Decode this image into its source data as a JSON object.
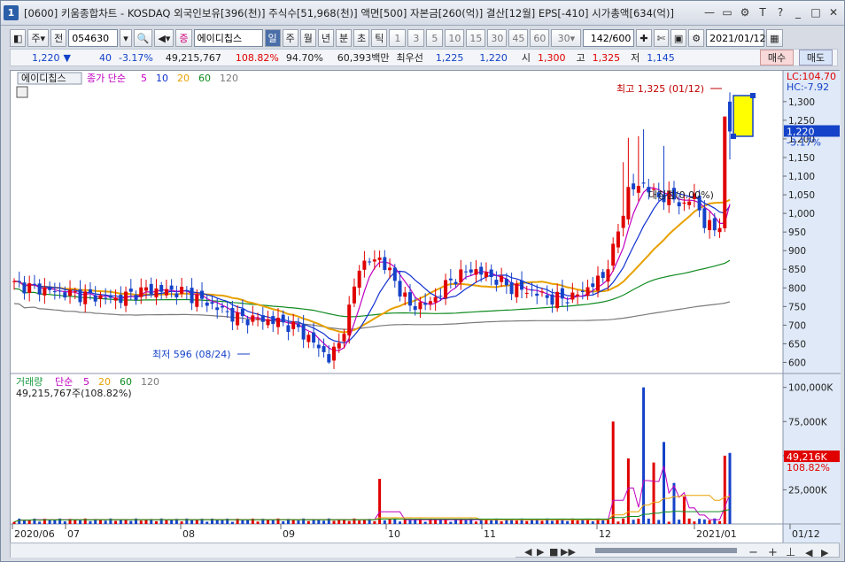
{
  "title": {
    "num": "1",
    "text": "[0600] 키움종합차트 - KOSDAQ 외국인보유[396(천)] 주식수[51,968(천)] 액면[500] 자본금[260(억)] 결산[12월] EPS[-410] 시가총액[634(억)]"
  },
  "toolbar": {
    "period_type": "주",
    "prev_label": "전",
    "code": "054630",
    "stock_badge": "증",
    "stock_name": "에이디칩스",
    "periods": [
      "일",
      "주",
      "월",
      "년",
      "분",
      "초",
      "틱"
    ],
    "intervals": [
      "1",
      "3",
      "5",
      "10",
      "15",
      "30",
      "45",
      "60"
    ],
    "interval_value": "30",
    "count": "142/600",
    "date": "2021/01/12"
  },
  "quote": {
    "price": "1,220",
    "arrow": "▼",
    "change": "40",
    "change_pct": "-3.17%",
    "volume": "49,215,767",
    "vol_ratio": "108.82%",
    "turnover": "94.70%",
    "amount": "60,393백만",
    "best_label": "최우선",
    "bid": "1,225",
    "ask": "1,220",
    "open_label": "시",
    "open": "1,300",
    "high_label": "고",
    "high": "1,325",
    "low_label": "저",
    "low": "1,145",
    "buy_label": "매수",
    "sell_label": "매도"
  },
  "chart_data": {
    "type": "candlestick",
    "stock_label": "에이디칩스",
    "ma_label": "종가 단순",
    "ma_periods": [
      "5",
      "10",
      "20",
      "60",
      "120"
    ],
    "ma_colors": [
      "#c000c0",
      "#1030d0",
      "#e8a000",
      "#108a20",
      "#7a7a7a"
    ],
    "y_ticks": [
      "1,300",
      "1,250",
      "1,200",
      "1,150",
      "1,100",
      "1,050",
      "1,000",
      "950",
      "900",
      "850",
      "800",
      "750",
      "700",
      "650",
      "600"
    ],
    "lc_label": "LC:104.70",
    "hc_label": "HC:-7.92",
    "last_price": "1,220",
    "last_pct": "-3.17%",
    "max_note": "최고 1,325 (01/12)",
    "min_note": "최저 596 (08/24)",
    "trend_note": "대칭점(0.00%)",
    "x_labels": [
      "2020/06",
      "07",
      "08",
      "09",
      "10",
      "11",
      "12",
      "2021/01",
      "01/12"
    ],
    "volume_label": "거래량",
    "volume_ma_label": "단순",
    "volume_ma_periods": [
      "5",
      "20",
      "60",
      "120"
    ],
    "volume_value": "49,215,767주(108.82%)",
    "vol_ticks": [
      "100,000K",
      "75,000K",
      "50,000K",
      "25,000K"
    ],
    "vol_last": "49,216K",
    "vol_last_pct": "108.82%",
    "up_color": "#e00000",
    "down_color": "#1442c8"
  }
}
